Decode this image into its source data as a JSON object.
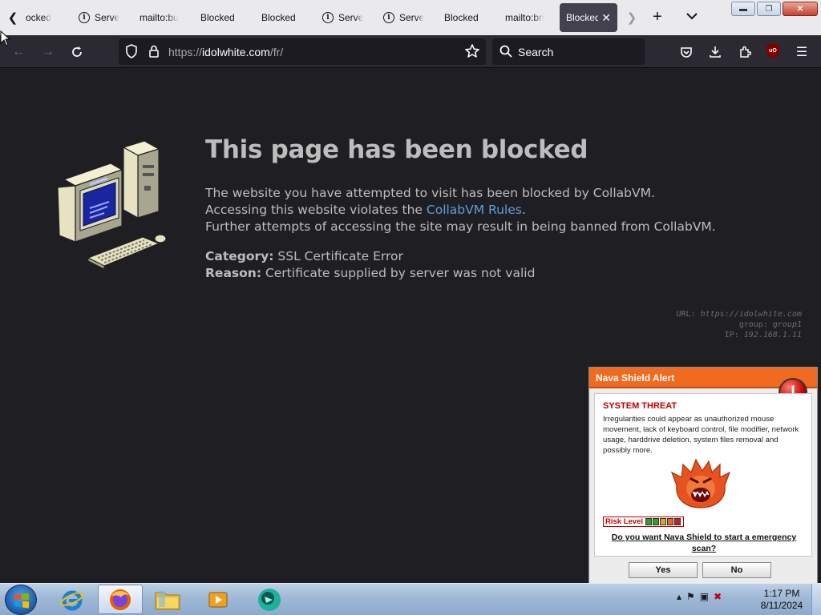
{
  "browser": {
    "tabs": [
      {
        "label": "ocked",
        "icon": "none"
      },
      {
        "label": "Serve",
        "icon": "info-icon"
      },
      {
        "label": "mailto:bu",
        "icon": "none"
      },
      {
        "label": "Blocked",
        "icon": "none"
      },
      {
        "label": "Blocked",
        "icon": "none"
      },
      {
        "label": "Serve",
        "icon": "info-icon"
      },
      {
        "label": "Serve",
        "icon": "info-icon"
      },
      {
        "label": "Blocked",
        "icon": "none"
      },
      {
        "label": "mailto:bri",
        "icon": "none"
      },
      {
        "label": "Blocked",
        "icon": "none",
        "active": true
      }
    ],
    "url": {
      "prefix": "https://",
      "host": "idolwhite.com",
      "path": "/fr/"
    },
    "search_placeholder": "Search",
    "ublock_badge": "uO",
    "colors": {
      "tabstrip": "#eaeaed",
      "toolbar": "#2b2a33",
      "urlbar": "#1c1b22"
    }
  },
  "page": {
    "title": "This page has been blocked",
    "line1": "The website you have attempted to visit has been blocked by CollabVM.",
    "line2_prefix": "Accessing this website violates the ",
    "line2_link": "CollabVM Rules",
    "line2_suffix": ".",
    "line3": "Further attempts of accessing the site may result in being banned from CollabVM.",
    "category_label": "Category:",
    "category_value": "SSL Certificate Error",
    "reason_label": "Reason:",
    "reason_value": "Certificate supplied by server was not valid",
    "meta": {
      "url_label": "URL:",
      "url_value": "https://idolwhite.com",
      "group_label": "group:",
      "group_value": "group1",
      "ip_label": "IP:",
      "ip_value": "192.168.1.11"
    },
    "colors": {
      "background": "#1f1f23",
      "text": "#bdbdbd",
      "link": "#5e9fdc"
    }
  },
  "nava": {
    "header": "Nava Shield Alert",
    "threat_title": "SYSTEM THREAT",
    "description": "Irregularities could appear as unauthorized mouse movement, lack of keyboard control, file modifier, network usage, harddrive deletion, system files removal and possibly more.",
    "risk_label": "Risk Level",
    "risk_cells": [
      "#2fa02f",
      "#2fa02f",
      "#e0a020",
      "#e06a20",
      "#c02020"
    ],
    "question": "Do you want Nava Shield to start a emergency scan?",
    "yes": "Yes",
    "no": "No",
    "colors": {
      "header": "#f06a20",
      "threat": "#c00000"
    }
  },
  "taskbar": {
    "items": [
      "internet-explorer-icon",
      "firefox-icon",
      "file-explorer-icon",
      "media-player-icon",
      "app-icon"
    ],
    "active_item": "firefox-icon",
    "time": "1:17 PM",
    "date": "8/11/2024"
  }
}
